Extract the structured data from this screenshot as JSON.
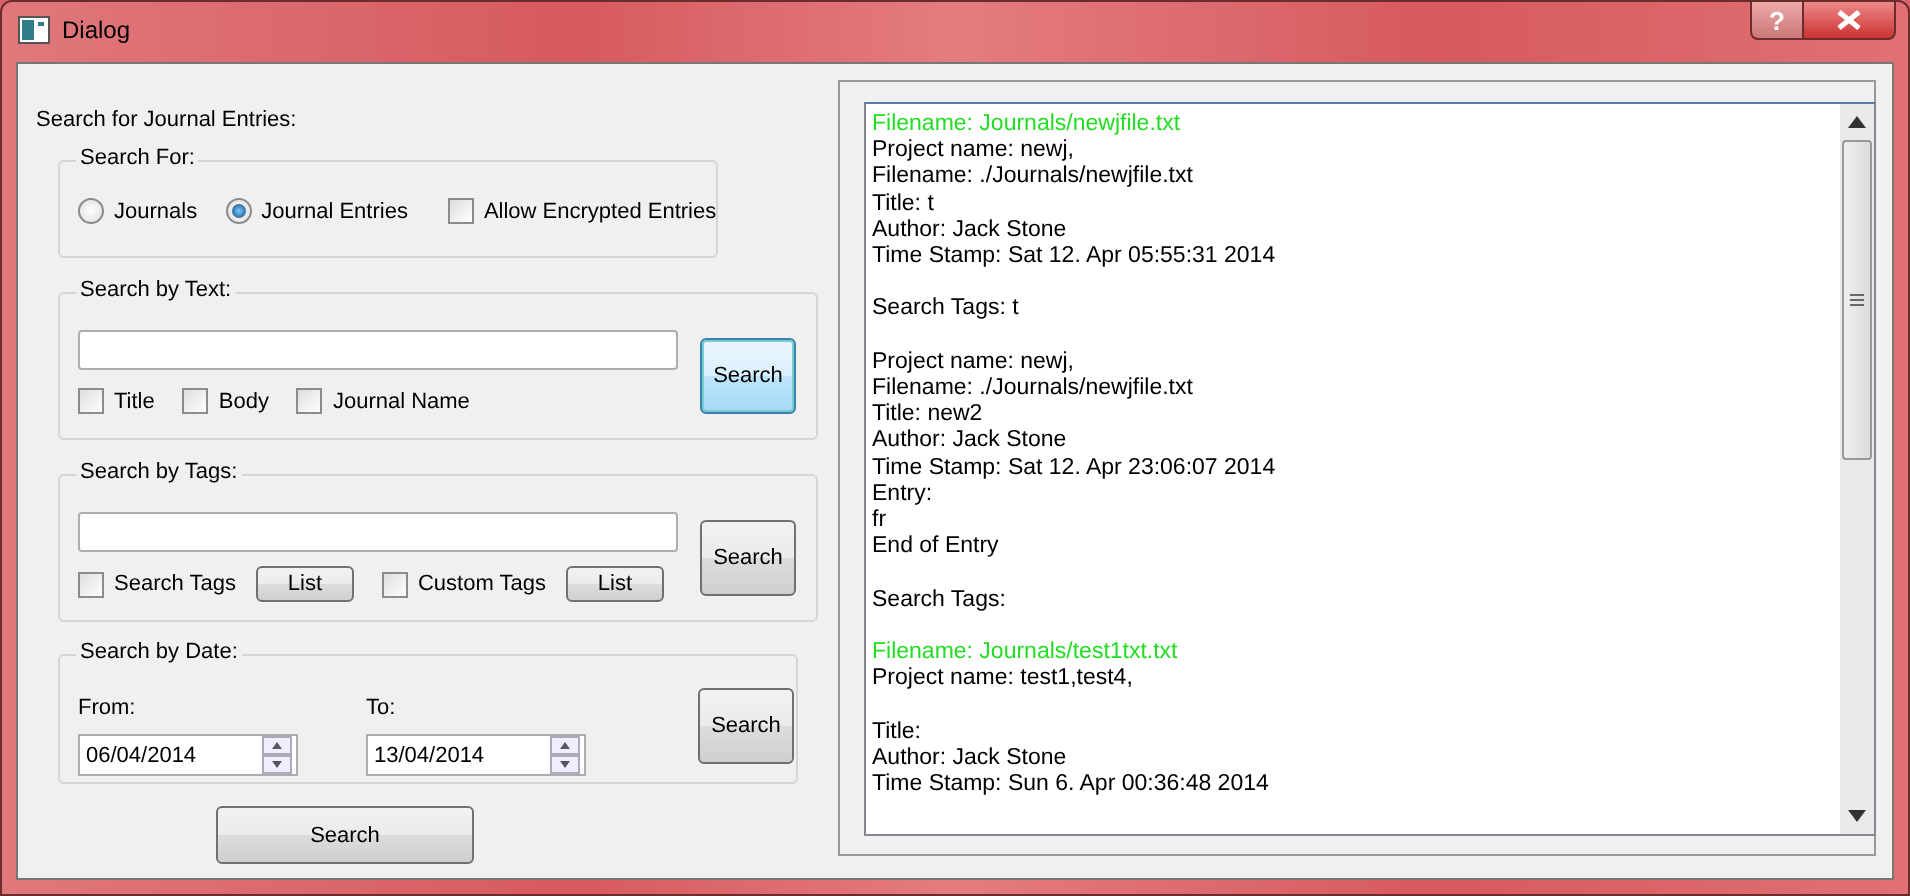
{
  "window": {
    "title": "Dialog",
    "help_label": "?"
  },
  "heading": "Search for Journal Entries:",
  "search_for": {
    "title": "Search For:",
    "options": [
      {
        "kind": "radio",
        "label": "Journals",
        "selected": false
      },
      {
        "kind": "radio",
        "label": "Journal Entries",
        "selected": true
      },
      {
        "kind": "checkbox",
        "label": "Allow Encrypted Entries",
        "checked": false
      }
    ]
  },
  "search_by_text": {
    "title": "Search by Text:",
    "button": "Search",
    "button_focused": true,
    "checkboxes": [
      {
        "label": "Title",
        "checked": false
      },
      {
        "label": "Body",
        "checked": false
      },
      {
        "label": "Journal Name",
        "checked": false
      }
    ]
  },
  "search_by_tags": {
    "title": "Search by Tags:",
    "button": "Search",
    "options": [
      {
        "label": "Search Tags",
        "checked": false,
        "button": "List"
      },
      {
        "label": "Custom Tags",
        "checked": false,
        "button": "List"
      }
    ]
  },
  "search_by_date": {
    "title": "Search by Date:",
    "button": "Search",
    "fields": [
      {
        "label": "From:",
        "value": "06/04/2014"
      },
      {
        "label": "To:",
        "value": "13/04/2014"
      }
    ]
  },
  "main_button": "Search",
  "results": [
    [
      {
        "text": "Filename: Journals/newjfile.txt",
        "highlight": true
      },
      {
        "text": "Project name: newj,",
        "highlight": false
      },
      {
        "text": "Filename: ./Journals/newjfile.txt",
        "highlight": false
      },
      {
        "text": "Title: t",
        "highlight": false
      },
      {
        "text": "Author: Jack Stone",
        "highlight": false
      },
      {
        "text": "Time Stamp: Sat 12. Apr 05:55:31 2014",
        "highlight": false
      }
    ],
    [
      {
        "text": "Search Tags: t",
        "highlight": false
      }
    ],
    [
      {
        "text": "Project name: newj,",
        "highlight": false
      },
      {
        "text": "Filename: ./Journals/newjfile.txt",
        "highlight": false
      },
      {
        "text": "Title: new2",
        "highlight": false
      },
      {
        "text": "Author: Jack Stone",
        "highlight": false
      },
      {
        "text": "Time Stamp: Sat 12. Apr 23:06:07 2014",
        "highlight": false
      },
      {
        "text": "Entry:",
        "highlight": false
      },
      {
        "text": "fr",
        "highlight": false
      },
      {
        "text": "End of Entry",
        "highlight": false
      }
    ],
    [
      {
        "text": "Search Tags:",
        "highlight": false
      }
    ],
    [
      {
        "text": "Filename: Journals/test1txt.txt",
        "highlight": true
      },
      {
        "text": "Project name: test1,test4,",
        "highlight": false
      }
    ],
    [
      {
        "text": "Title:",
        "highlight": false
      },
      {
        "text": "Author: Jack Stone",
        "highlight": false
      },
      {
        "text": "Time Stamp: Sun 6. Apr 00:36:48 2014",
        "highlight": false
      }
    ]
  ]
}
